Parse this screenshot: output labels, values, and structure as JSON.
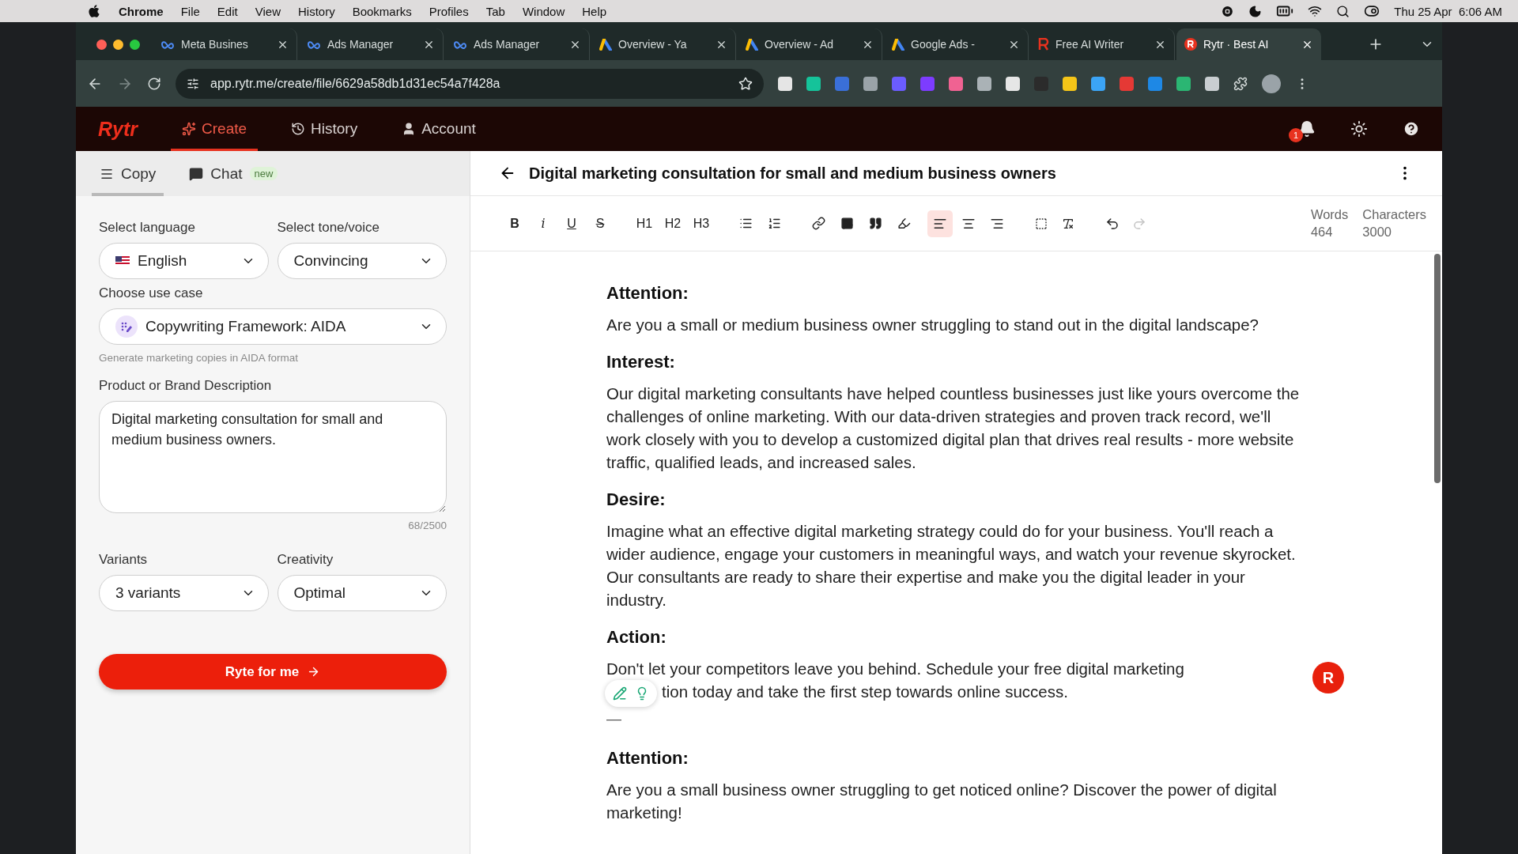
{
  "menubar": {
    "app": "Chrome",
    "menus": [
      "File",
      "Edit",
      "View",
      "History",
      "Bookmarks",
      "Profiles",
      "Tab",
      "Window",
      "Help"
    ],
    "clock": "Thu 25 Apr  6:06 AM"
  },
  "browser": {
    "tabs": [
      {
        "title": "Meta Busines",
        "kind": "meta",
        "selected": false
      },
      {
        "title": "Ads Manager",
        "kind": "meta",
        "selected": false
      },
      {
        "title": "Ads Manager",
        "kind": "meta",
        "selected": false
      },
      {
        "title": "Overview - Ya",
        "kind": "ads",
        "selected": false
      },
      {
        "title": "Overview - Ad",
        "kind": "ads",
        "selected": false
      },
      {
        "title": "Google Ads -",
        "kind": "ads",
        "selected": false
      },
      {
        "title": "Free AI Writer",
        "kind": "writer",
        "selected": false
      },
      {
        "title": "Rytr · Best AI",
        "kind": "rytr",
        "selected": true
      }
    ],
    "url": "app.rytr.me/create/file/6629a58db1d31ec54a7f428a"
  },
  "app": {
    "logo": "Rytr",
    "nav": [
      {
        "label": "Create",
        "kind": "create",
        "selected": true
      },
      {
        "label": "History",
        "kind": "history",
        "selected": false
      },
      {
        "label": "Account",
        "kind": "account",
        "selected": false
      }
    ],
    "notification_count": "1"
  },
  "sidebar": {
    "tabs": [
      {
        "label": "Copy",
        "kind": "copy",
        "selected": true
      },
      {
        "label": "Chat",
        "kind": "chat",
        "badge": "new",
        "selected": false
      }
    ],
    "language": {
      "label": "Select language",
      "value": "English"
    },
    "tone": {
      "label": "Select tone/voice",
      "value": "Convincing"
    },
    "use_case": {
      "label": "Choose use case",
      "value": "Copywriting Framework: AIDA",
      "hint": "Generate marketing copies in AIDA format"
    },
    "description": {
      "label": "Product or Brand Description",
      "value": "Digital marketing consultation for small and medium business owners.",
      "counter": "68/2500"
    },
    "variants": {
      "label": "Variants",
      "value": "3 variants"
    },
    "creativity": {
      "label": "Creativity",
      "value": "Optimal"
    },
    "submit": "Ryte for me"
  },
  "editor": {
    "title": "Digital marketing consultation for small and medium business owners",
    "toolbar": {
      "text_buttons": [
        "B",
        "i",
        "U",
        "S",
        "H1",
        "H2",
        "H3"
      ],
      "align": [
        {
          "selected": true
        },
        {
          "selected": false
        },
        {
          "selected": false
        }
      ],
      "redo_disabled": true
    },
    "stats": [
      {
        "label": "Words",
        "value": "464"
      },
      {
        "label": "Characters",
        "value": "3000"
      }
    ],
    "blocks": [
      {
        "kind": "heading",
        "text": "Attention:"
      },
      {
        "kind": "paragraph",
        "text": "Are you a small or medium business owner struggling to stand out in the digital landscape?"
      },
      {
        "kind": "heading",
        "text": "Interest:"
      },
      {
        "kind": "paragraph",
        "text": "Our digital marketing consultants have helped countless businesses just like yours overcome the challenges of online marketing. With our data-driven strategies and proven track record, we'll work closely with you to develop a customized digital plan that drives real results - more website traffic, qualified leads, and increased sales."
      },
      {
        "kind": "heading",
        "text": "Desire:"
      },
      {
        "kind": "paragraph",
        "text": "Imagine what an effective digital marketing strategy could do for your business. You'll reach a wider audience, engage your customers in meaningful ways, and watch your revenue skyrocket. Our consultants are ready to share their expertise and make you the digital leader in your industry."
      },
      {
        "kind": "heading",
        "text": "Action:"
      },
      {
        "kind": "interrupted",
        "before": "Don't let your competitors leave you behind. Schedule your free digital marketing",
        "after": "tion today and take the first step towards online success."
      },
      {
        "kind": "rule",
        "text": "—"
      },
      {
        "kind": "heading",
        "text": "Attention:"
      },
      {
        "kind": "paragraph",
        "text": "Are you a small business owner struggling to get noticed online? Discover the power of digital marketing!"
      }
    ],
    "assistant_button": "R"
  }
}
